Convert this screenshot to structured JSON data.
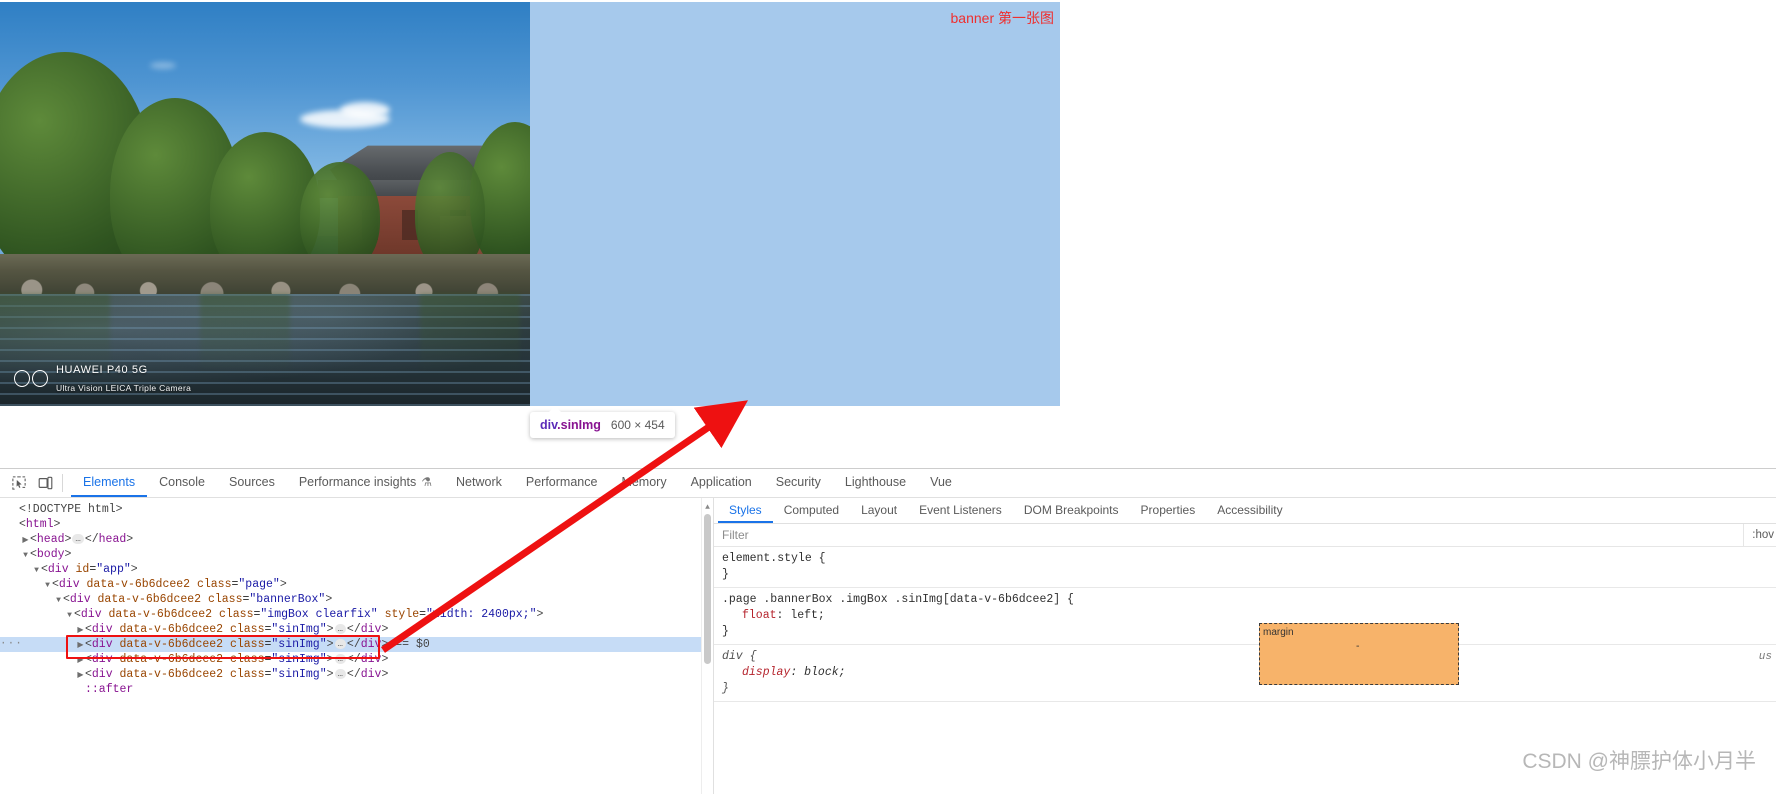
{
  "page": {
    "banner_label": "banner 第一张图",
    "photo_watermark": {
      "line1": "HUAWEI P40 5G",
      "line2": "Ultra Vision LEICA Triple Camera"
    }
  },
  "inspect_tooltip": {
    "selector_tag": "div",
    "selector_class": ".sinImg",
    "dimensions": "600 × 454"
  },
  "devtools": {
    "toolbar_icons": [
      "inspect-element-icon",
      "device-toolbar-icon"
    ],
    "tabs": [
      {
        "label": "Elements",
        "active": true
      },
      {
        "label": "Console",
        "active": false
      },
      {
        "label": "Sources",
        "active": false
      },
      {
        "label": "Performance insights",
        "active": false,
        "flask": "⚗"
      },
      {
        "label": "Network",
        "active": false
      },
      {
        "label": "Performance",
        "active": false
      },
      {
        "label": "Memory",
        "active": false
      },
      {
        "label": "Application",
        "active": false
      },
      {
        "label": "Security",
        "active": false
      },
      {
        "label": "Lighthouse",
        "active": false
      },
      {
        "label": "Vue",
        "active": false
      }
    ],
    "dom_lines": [
      {
        "indent": 0,
        "twisty": "none",
        "html": "<span class=\"punc\">&lt;!DOCTYPE html&gt;</span>"
      },
      {
        "indent": 0,
        "twisty": "none",
        "html": "<span class=\"punc\">&lt;</span><span class=\"tag\">html</span><span class=\"punc\">&gt;</span>"
      },
      {
        "indent": 1,
        "twisty": "right",
        "html": "<span class=\"punc\">&lt;</span><span class=\"tag\">head</span><span class=\"punc\">&gt;</span><span class=\"ellip\">…</span><span class=\"punc\">&lt;/</span><span class=\"tag\">head</span><span class=\"punc\">&gt;</span>"
      },
      {
        "indent": 1,
        "twisty": "down",
        "html": "<span class=\"punc\">&lt;</span><span class=\"tag\">body</span><span class=\"punc\">&gt;</span>"
      },
      {
        "indent": 2,
        "twisty": "down",
        "html": "<span class=\"punc\">&lt;</span><span class=\"tag\">div</span> <span class=\"attr\">id</span>=<span class=\"val\">\"app\"</span><span class=\"punc\">&gt;</span>"
      },
      {
        "indent": 3,
        "twisty": "down",
        "html": "<span class=\"punc\">&lt;</span><span class=\"tag\">div</span> <span class=\"attr\">data-v-6b6dcee2</span> <span class=\"attr\">class</span>=<span class=\"val\">\"page\"</span><span class=\"punc\">&gt;</span>"
      },
      {
        "indent": 4,
        "twisty": "down",
        "html": "<span class=\"punc\">&lt;</span><span class=\"tag\">div</span> <span class=\"attr\">data-v-6b6dcee2</span> <span class=\"attr\">class</span>=<span class=\"val\">\"bannerBox\"</span><span class=\"punc\">&gt;</span>"
      },
      {
        "indent": 5,
        "twisty": "down",
        "html": "<span class=\"punc\">&lt;</span><span class=\"tag\">div</span> <span class=\"attr\">data-v-6b6dcee2</span> <span class=\"attr\">class</span>=<span class=\"val\">\"imgBox clearfix\"</span> <span class=\"attr\">style</span>=<span class=\"val\">\"width: 2400px;\"</span><span class=\"punc\">&gt;</span>"
      },
      {
        "indent": 6,
        "twisty": "right",
        "html": "<span class=\"punc\">&lt;</span><span class=\"tag\">div</span> <span class=\"attr\">data-v-6b6dcee2</span> <span class=\"attr\">class</span>=<span class=\"val\">\"sinImg\"</span><span class=\"punc\">&gt;</span><span class=\"ellip\">…</span><span class=\"punc\">&lt;/</span><span class=\"tag\">div</span><span class=\"punc\">&gt;</span>"
      },
      {
        "indent": 6,
        "twisty": "right",
        "selected": true,
        "gutter": "···",
        "html": "<span class=\"punc\">&lt;</span><span class=\"tag\">div</span> <span class=\"attr\">data-v-6b6dcee2</span> <span class=\"attr\">class</span>=<span class=\"val\">\"sinImg\"</span><span class=\"punc\">&gt;</span><span class=\"ellip\">…</span><span class=\"punc\">&lt;/</span><span class=\"tag\">div</span><span class=\"punc\">&gt;</span> <span class=\"dollar\">== $0</span>"
      },
      {
        "indent": 6,
        "twisty": "right",
        "html": "<span class=\"punc\">&lt;</span><span class=\"tag\">div</span> <span class=\"attr\">data-v-6b6dcee2</span> <span class=\"attr\">class</span>=<span class=\"val\">\"sinImg\"</span><span class=\"punc\">&gt;</span><span class=\"ellip\">…</span><span class=\"punc\">&lt;/</span><span class=\"tag\">div</span><span class=\"punc\">&gt;</span>"
      },
      {
        "indent": 6,
        "twisty": "right",
        "html": "<span class=\"punc\">&lt;</span><span class=\"tag\">div</span> <span class=\"attr\">data-v-6b6dcee2</span> <span class=\"attr\">class</span>=<span class=\"val\">\"sinImg\"</span><span class=\"punc\">&gt;</span><span class=\"ellip\">…</span><span class=\"punc\">&lt;/</span><span class=\"tag\">div</span><span class=\"punc\">&gt;</span>"
      },
      {
        "indent": 6,
        "twisty": "none",
        "html": "<span class=\"pseudo\">::after</span>"
      }
    ],
    "sidebar_tabs": [
      {
        "label": "Styles",
        "active": true
      },
      {
        "label": "Computed",
        "active": false
      },
      {
        "label": "Layout",
        "active": false
      },
      {
        "label": "Event Listeners",
        "active": false
      },
      {
        "label": "DOM Breakpoints",
        "active": false
      },
      {
        "label": "Properties",
        "active": false
      },
      {
        "label": "Accessibility",
        "active": false
      }
    ],
    "filter_placeholder": "Filter",
    "filter_value": "",
    "hov_button": ":hov",
    "style_rules": [
      {
        "selector": "element.style {",
        "close": "}",
        "declarations": [],
        "origin": "",
        "ua": false
      },
      {
        "selector": ".page .bannerBox .imgBox .sinImg[data-v-6b6dcee2] {",
        "close": "}",
        "declarations": [
          {
            "property": "float",
            "value": "left;"
          }
        ],
        "origin": "",
        "ua": false
      },
      {
        "selector": "div {",
        "close": "}",
        "declarations": [
          {
            "property": "display",
            "value": "block;"
          }
        ],
        "origin": "us",
        "ua": true
      }
    ],
    "box_model": {
      "label": "margin",
      "value": "-"
    }
  },
  "watermark": "CSDN @神膘护体小月半",
  "colors": {
    "accent": "#1a73e8",
    "annotation_red": "#ee1111",
    "selection_blue": "#c6dcf6",
    "placeholder_blue": "#a6c9ec",
    "margin_box": "#f7b36a"
  }
}
